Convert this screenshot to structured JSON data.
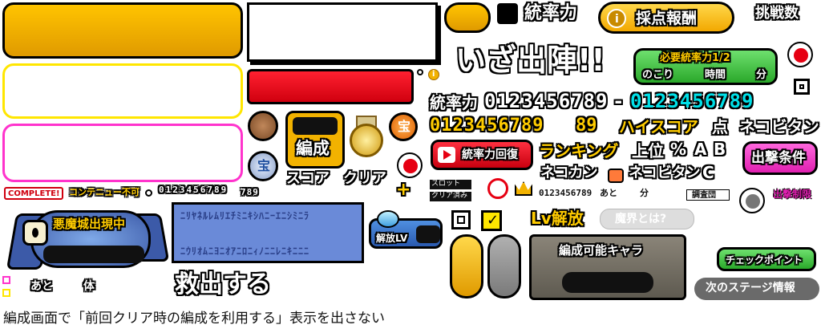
{
  "colors": {
    "gold": "#f2b200",
    "red": "#e60012",
    "green": "#39c539",
    "magenta": "#ff33cc",
    "yellow_border": "#ffe600",
    "cyan": "#00e0e8",
    "stone": "#6f6a5e"
  },
  "labels": {
    "command_power": "統率力",
    "reward_button": "採点報酬",
    "challenge_count": "挑戦数",
    "go_to_battle": "いざ出陣!!",
    "required_power": "必要統率力1/2",
    "remaining": "のこり",
    "time": "時間",
    "minutes": "分",
    "digits_white": "0123456789",
    "digits_cyan": "0123456789",
    "digits_yellow": "0123456789",
    "dash": "-",
    "command_power_recovery": "統率力回復",
    "high_score": "ハイスコア",
    "points": "点",
    "neko_vitan": "ネコビタン",
    "sortie_condition": "出撃条件",
    "sortie_limit": "出撃制限",
    "ranking": "ランキング",
    "top": "上位",
    "percent": "%",
    "rank_a": "A",
    "rank_b": "B",
    "rank_c": "C",
    "nekokan": "ネコカン",
    "neko_vitan2": "ネコビタン",
    "slot": "スロット",
    "clear_done": "クリア済み",
    "small_digits": "0123456789",
    "remaining_short": "あと",
    "minute_short": "分",
    "investigation_team": "調査団",
    "formation": "編成",
    "score": "スコア",
    "clear": "クリア",
    "plus": "+",
    "treasure": "宝",
    "complete": "COMPLETE!",
    "no_continue": "コンテニュー不可",
    "demon_castle": "悪魔城出現中",
    "remaining_body": "あと",
    "body_unit": "体",
    "rescue": "救出する",
    "unlock_lv": "解放LV",
    "lv_unlock": "Lv解放",
    "what_is_demon_world": "魔界とは?",
    "formable_chara": "編成可能キャラ",
    "checkpoint": "チェックポイント",
    "next_stage_info": "次のステージ情報",
    "info_icon": "i",
    "bottom_option": "編成画面で「前回クリア時の編成を利用する」表示を出さない",
    "pixel_text_row1": "ﾆﾘﾔﾈﾙﾚﾑﾘｴﾁﾐﾆｷｼﾊﾆｰｴﾆｼﾐﾆﾗ",
    "pixel_text_row2": "ﾆｳﾘｵﾑﾆﾖﾆｵｱﾆﾛﾆｨﾉﾆﾆﾚﾆｷﾆﾆﾆ"
  }
}
